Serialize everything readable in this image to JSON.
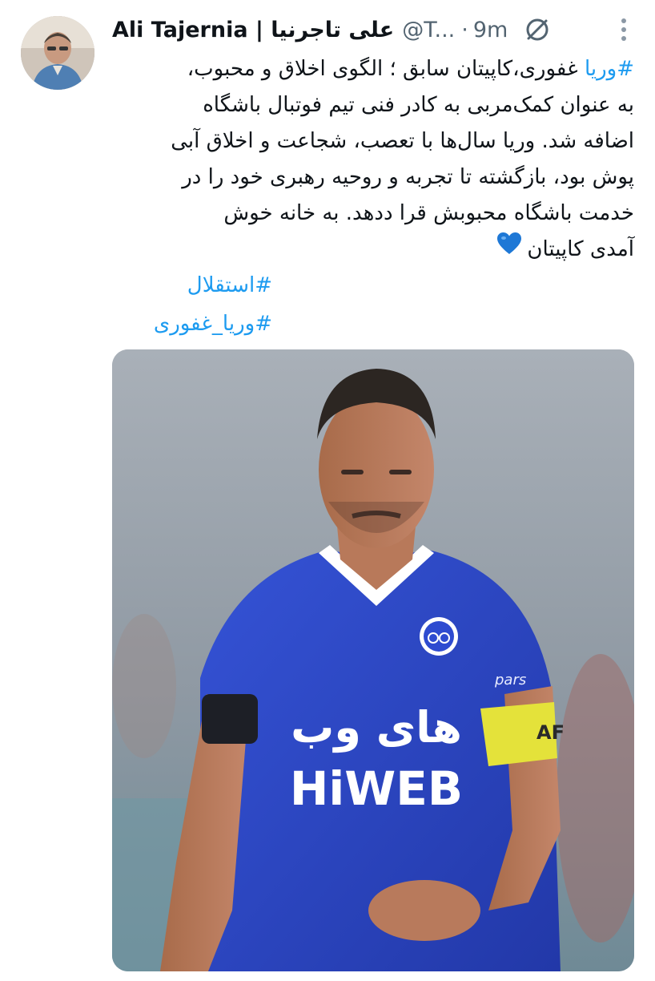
{
  "tweet": {
    "author_name": "Ali Tajernia | علی تاجرنیا",
    "author_handle": "@T...",
    "separator": "·",
    "time": "9m",
    "avatar_icon": "user-avatar",
    "muted_icon": "muted-conversation-icon",
    "more_icon": "more-options-icon",
    "body": {
      "line1_tag": "#وریا",
      "line1_rest": " غفوری،کاپیتان سابق ؛ الگوی اخلاق و محبوب،",
      "line2": "به عنوان کمک‌مربی به کادر فنی تیم فوتبال باشگاه",
      "line3": "اضافه شد. وریا سال‌ها با تعصب، شجاعت و اخلاق آبی",
      "line4": "پوش بود،  بازگشته تا تجربه و روحیه رهبری خود را در",
      "line5": "خدمت  باشگاه محبوبش قرا ددهد. به خانه خوش",
      "line6": "آمدی کاپیتان",
      "emoji_icon": "blue-heart-icon"
    },
    "hashtags": [
      "#استقلال",
      "#وریا_غفوری"
    ],
    "media": {
      "jersey_sponsor_persian": "های وب",
      "jersey_sponsor_latin": "HiWEB",
      "jersey_side_text": "pars",
      "armband_text": "AF",
      "colors": {
        "jersey": "#2b46c8",
        "armband": "#e4e23a",
        "background": "#8e9aa6"
      }
    }
  }
}
